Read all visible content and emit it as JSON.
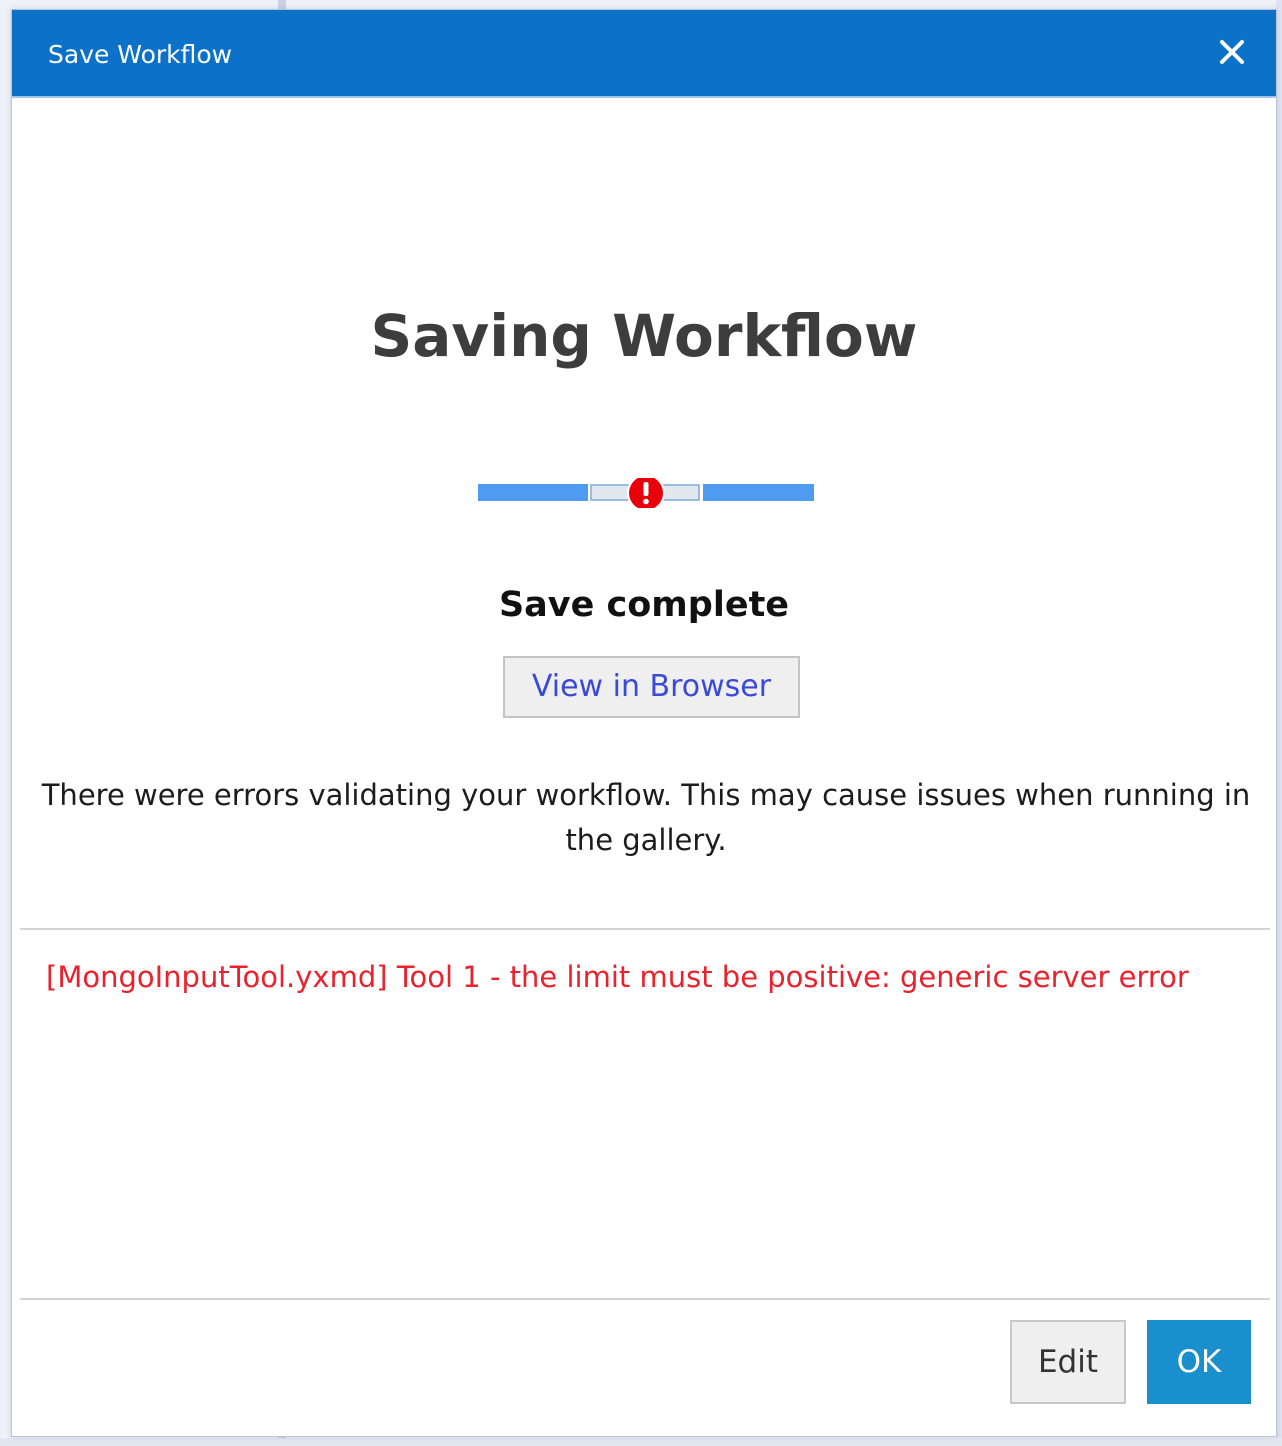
{
  "dialog": {
    "title": "Save Workflow",
    "close_icon": "close-icon"
  },
  "main": {
    "heading": "Saving Workflow",
    "progress": {
      "state": "error",
      "error_icon": "error-exclamation-icon",
      "bar_color": "#4f9bf2",
      "error_color": "#e8000b"
    },
    "status": "Save complete",
    "view_button_label": "View in Browser",
    "message": "There were errors validating your workflow. This may cause issues when running in the gallery."
  },
  "errors": [
    "[MongoInputTool.yxmd] Tool 1 - the limit must be positive: generic server error"
  ],
  "footer": {
    "edit_label": "Edit",
    "ok_label": "OK"
  },
  "colors": {
    "titlebar": "#0b71c9",
    "error_text": "#e8232d",
    "ok_button": "#1a8fcd",
    "link_text": "#3b4ad6"
  }
}
